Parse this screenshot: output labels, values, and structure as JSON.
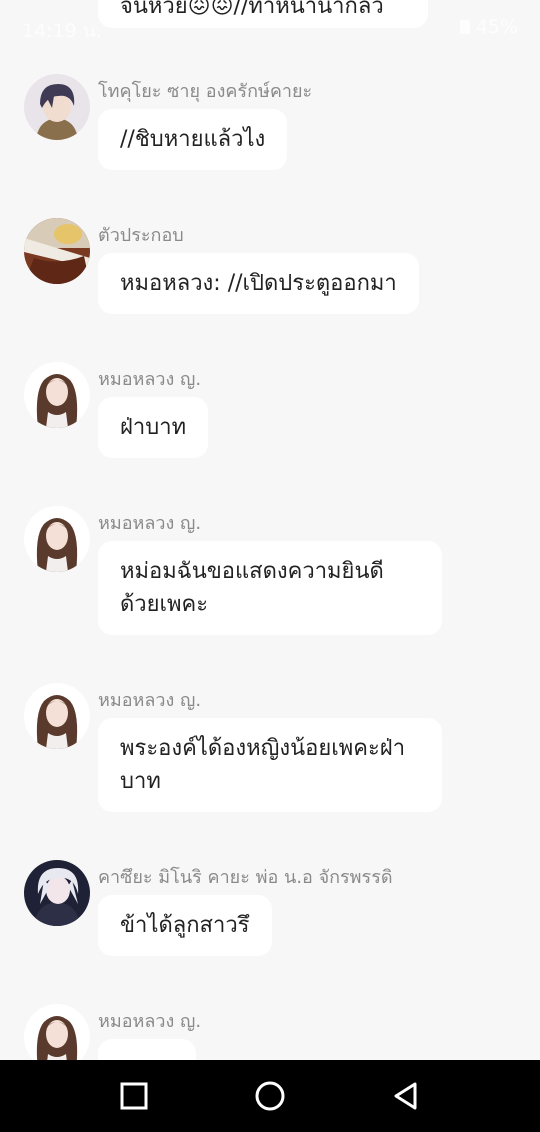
{
  "status_bar": {
    "time": "14:19 น.",
    "battery": "45%"
  },
  "top_partial": {
    "text": "จนหวย😖😖//ทำหน้านำกล้ว"
  },
  "messages": [
    {
      "sender": "โทคุโยะ ซายุ องครักษ์คายะ",
      "text": "//ชิบหายแล้วไง",
      "avatar": "male-purple-hair"
    },
    {
      "sender": "ตัวประกอบ",
      "text": "หมอหลวง: //เปิดประตูออกมา",
      "avatar": "scene-blond"
    },
    {
      "sender": "หมอหลวง ญ.",
      "text": "ฝ่าบาท",
      "avatar": "female-brown-hair"
    },
    {
      "sender": "หมอหลวง ญ.",
      "text": "หม่อมฉันขอแสดงความยินดีด้วยเพคะ",
      "avatar": "female-brown-hair"
    },
    {
      "sender": "หมอหลวง ญ.",
      "text": "พระองค์ได้องหญิงน้อยเพคะฝ่าบาท",
      "avatar": "female-brown-hair"
    },
    {
      "sender": "คาซึยะ มิโนริ คายะ พ่อ น.อ จักรพรรดิ",
      "text": "ข้าได้ลูกสาวรึ",
      "avatar": "male-white-hair"
    },
    {
      "sender": "หมอหลวง ญ.",
      "text": "",
      "avatar": "female-brown-hair"
    }
  ],
  "nav": {
    "recents": "square-icon",
    "home": "circle-icon",
    "back": "triangle-icon"
  },
  "colors": {
    "background": "#f7f7f7",
    "bubble": "#ffffff",
    "sender": "#8a8a8a",
    "nav": "#000000"
  }
}
